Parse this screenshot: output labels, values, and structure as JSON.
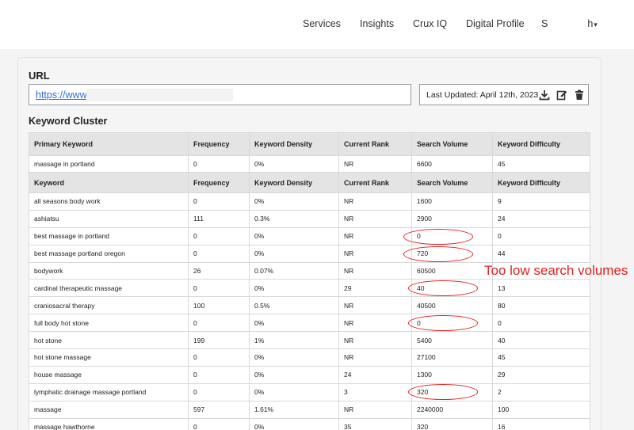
{
  "nav": {
    "items": [
      "Services",
      "Insights",
      "Crux IQ",
      "Digital Profile"
    ],
    "user_initial": "S",
    "user_suffix": "h",
    "caret": "▾"
  },
  "url_section": {
    "label": "URL",
    "value": "https://www."
  },
  "last_updated": {
    "text": "Last Updated: April 12th, 2023",
    "icons": [
      "download-icon",
      "edit-icon",
      "trash-icon"
    ]
  },
  "keyword_cluster": {
    "label": "Keyword Cluster",
    "primary_headers": [
      "Primary Keyword",
      "Frequency",
      "Keyword Density",
      "Current Rank",
      "Search Volume",
      "Keyword Difficulty"
    ],
    "primary_row": [
      "massage in portland",
      "0",
      "0%",
      "NR",
      "6600",
      "45"
    ],
    "headers": [
      "Keyword",
      "Frequency",
      "Keyword Density",
      "Current Rank",
      "Search Volume",
      "Keyword Difficulty"
    ],
    "rows": [
      [
        "all seasons body work",
        "0",
        "0%",
        "NR",
        "1600",
        "9"
      ],
      [
        "ashiatsu",
        "111",
        "0.3%",
        "NR",
        "2900",
        "24"
      ],
      [
        "best massage in portland",
        "0",
        "0%",
        "NR",
        "0",
        "0"
      ],
      [
        "best massage portland oregon",
        "0",
        "0%",
        "NR",
        "720",
        "44"
      ],
      [
        "bodywork",
        "26",
        "0.07%",
        "NR",
        "60500",
        ""
      ],
      [
        "cardinal therapeutic massage",
        "0",
        "0%",
        "29",
        "40",
        "13"
      ],
      [
        "craniosacral therapy",
        "100",
        "0.5%",
        "NR",
        "40500",
        "80"
      ],
      [
        "full body hot stone",
        "0",
        "0%",
        "NR",
        "0",
        "0"
      ],
      [
        "hot stone",
        "199",
        "1%",
        "NR",
        "5400",
        "40"
      ],
      [
        "hot stone massage",
        "0",
        "0%",
        "NR",
        "27100",
        "45"
      ],
      [
        "house massage",
        "0",
        "0%",
        "24",
        "1300",
        "29"
      ],
      [
        "lymphatic drainage massage portland",
        "0",
        "0%",
        "3",
        "320",
        "2"
      ],
      [
        "massage",
        "597",
        "1.61%",
        "NR",
        "2240000",
        "100"
      ],
      [
        "massage hawthorne",
        "0",
        "0%",
        "35",
        "320",
        "16"
      ]
    ]
  },
  "annotation": {
    "text": "Too low search volumes",
    "color": "#e01f1f"
  }
}
